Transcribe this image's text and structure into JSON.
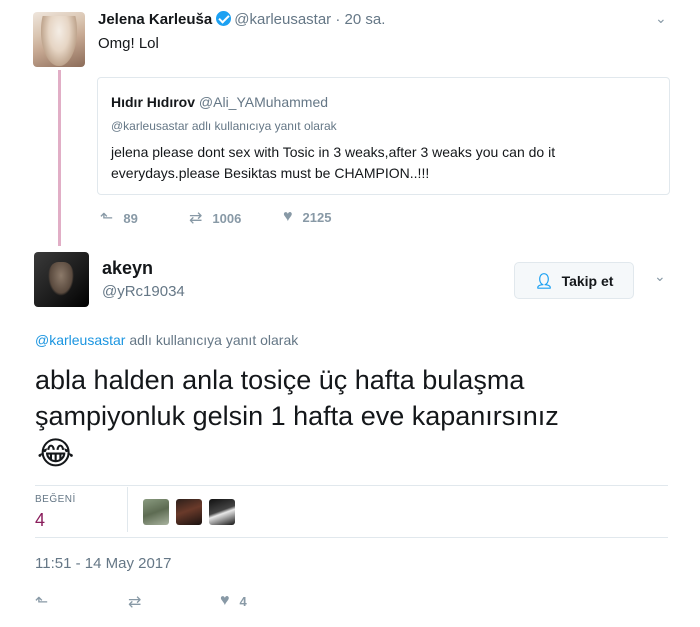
{
  "parent_tweet": {
    "name": "Jelena Karleuša",
    "handle": "@karleusastar",
    "separator": "·",
    "time": "20 sa.",
    "text": "Omg! Lol",
    "actions": {
      "reply_count": "89",
      "retweet_count": "1006",
      "like_count": "2125"
    }
  },
  "quoted_tweet": {
    "name": "Hıdır Hıdırov",
    "handle": "@Ali_YAMuhammed",
    "reply_context": "@karleusastar adlı kullanıcıya yanıt olarak",
    "text": "jelena please dont sex with Tosic in 3 weaks,after 3 weaks you can do it everydays.please Besiktas must be CHAMPION..!!!"
  },
  "main_tweet": {
    "name": "akeyn",
    "handle": "@yRc19034",
    "follow_label": "Takip et",
    "reply_handle": "@karleusastar",
    "reply_suffix": " adlı kullanıcıya yanıt olarak",
    "text": "abla halden anla tosiçe üç hafta bulaşma şampiyonluk gelsin 1 hafta eve kapanırsınız",
    "emoji": "😂",
    "stats_label": "BEĞENİ",
    "stats_value": "4",
    "timestamp": "11:51 - 14 May 2017",
    "like_count": "4"
  },
  "icons": {
    "reply": "reply-icon",
    "retweet": "retweet-icon",
    "like": "heart-icon",
    "chevron": "chevron-down-icon",
    "verified": "verified-badge-icon",
    "follow": "add-user-icon"
  },
  "colors": {
    "link": "#1b95e0",
    "thread_line": "#e1aec6",
    "like_stat": "#8a1e5c",
    "verified": "#1da1f2"
  }
}
